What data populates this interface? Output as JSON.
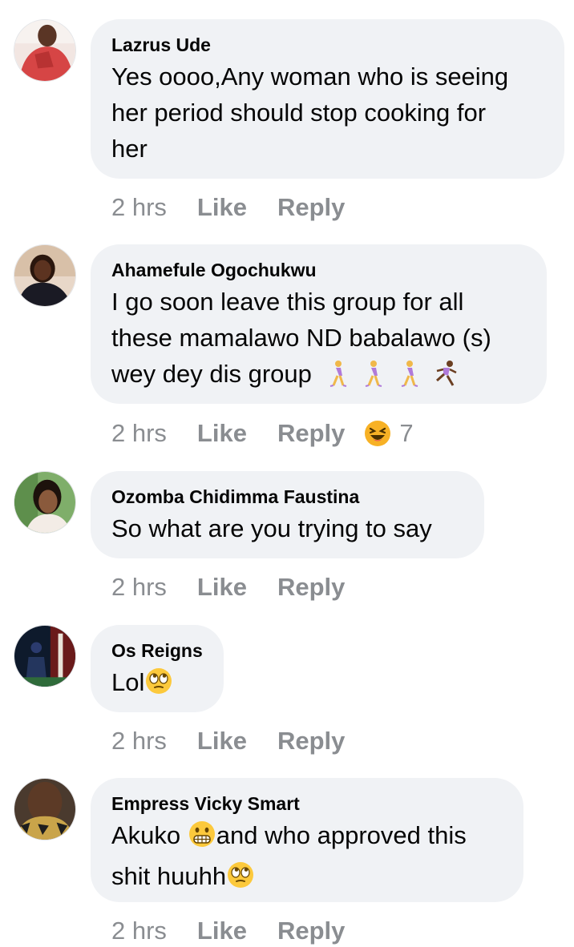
{
  "comments": [
    {
      "author": "Lazrus Ude",
      "lines": [
        "Yes oooo,Any woman who is seeing",
        "her period should stop cooking for",
        "her"
      ],
      "time": "2 hrs",
      "like": "Like",
      "reply": "Reply"
    },
    {
      "author": "Ahamefule Ogochukwu",
      "lines": [
        "I go soon leave this group for all",
        "these mamalawo ND babalawo (s)",
        "wey dey dis group"
      ],
      "emojis": [
        "woman-walking-icon",
        "woman-walking-icon",
        "woman-walking-icon",
        "woman-running-icon"
      ],
      "time": "2 hrs",
      "like": "Like",
      "reply": "Reply",
      "reaction": {
        "icon": "haha-reaction-icon",
        "count": "7"
      }
    },
    {
      "author": "Ozomba Chidimma Faustina",
      "lines": [
        "So what are you trying to say"
      ],
      "time": "2 hrs",
      "like": "Like",
      "reply": "Reply"
    },
    {
      "author": "Os Reigns",
      "lines": [
        "Lol"
      ],
      "emojis": [
        "eye-roll-emoji-icon"
      ],
      "time": "2 hrs",
      "like": "Like",
      "reply": "Reply"
    },
    {
      "author": "Empress Vicky Smart",
      "lines": [
        "Akuko",
        "and who approved this",
        "shit huuhh"
      ],
      "emojis": [
        "grimace-emoji-icon",
        "eye-roll-emoji-icon"
      ],
      "time": "2 hrs",
      "like": "Like",
      "reply": "Reply"
    }
  ],
  "colors": {
    "bubble": "#f0f2f5",
    "meta_text": "#8a8d91",
    "text": "#050505",
    "haha": "#f7b125"
  }
}
